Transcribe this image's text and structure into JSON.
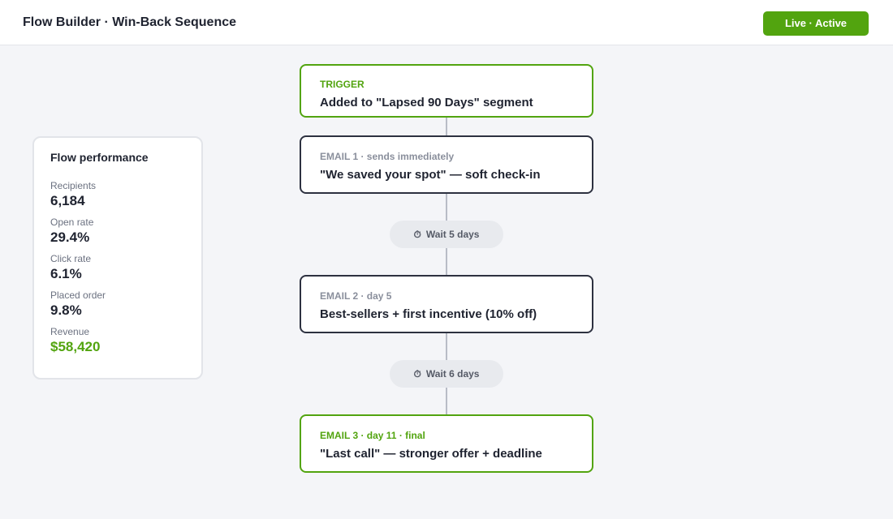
{
  "header": {
    "title": "Flow Builder · Win-Back Sequence",
    "status_label": "Live · Active"
  },
  "performance": {
    "title": "Flow performance",
    "metrics": [
      {
        "label": "Recipients",
        "value": "6,184"
      },
      {
        "label": "Open rate",
        "value": "29.4%"
      },
      {
        "label": "Click rate",
        "value": "6.1%"
      },
      {
        "label": "Placed order",
        "value": "9.8%"
      },
      {
        "label": "Revenue",
        "value": "$58,420"
      }
    ]
  },
  "flow": {
    "trigger": {
      "kicker": "TRIGGER",
      "text": "Added to \"Lapsed 90 Days\" segment"
    },
    "email1": {
      "kicker": "EMAIL 1 · sends immediately",
      "text": "\"We saved your spot\" — soft check-in"
    },
    "wait1": {
      "icon": "⏱",
      "icon_name": "timer-icon",
      "label": "Wait 5 days"
    },
    "email2": {
      "kicker": "EMAIL 2 · day 5",
      "text": "Best-sellers + first incentive (10% off)"
    },
    "wait2": {
      "icon": "⏱",
      "icon_name": "timer-icon",
      "label": "Wait 6 days"
    },
    "email3": {
      "kicker": "EMAIL 3 · day 11 · final",
      "text": "\"Last call\" — stronger offer + deadline"
    }
  },
  "colors": {
    "accent_green": "#52a40f",
    "node_border_dark": "#2d3140",
    "background": "#f4f5f8"
  }
}
